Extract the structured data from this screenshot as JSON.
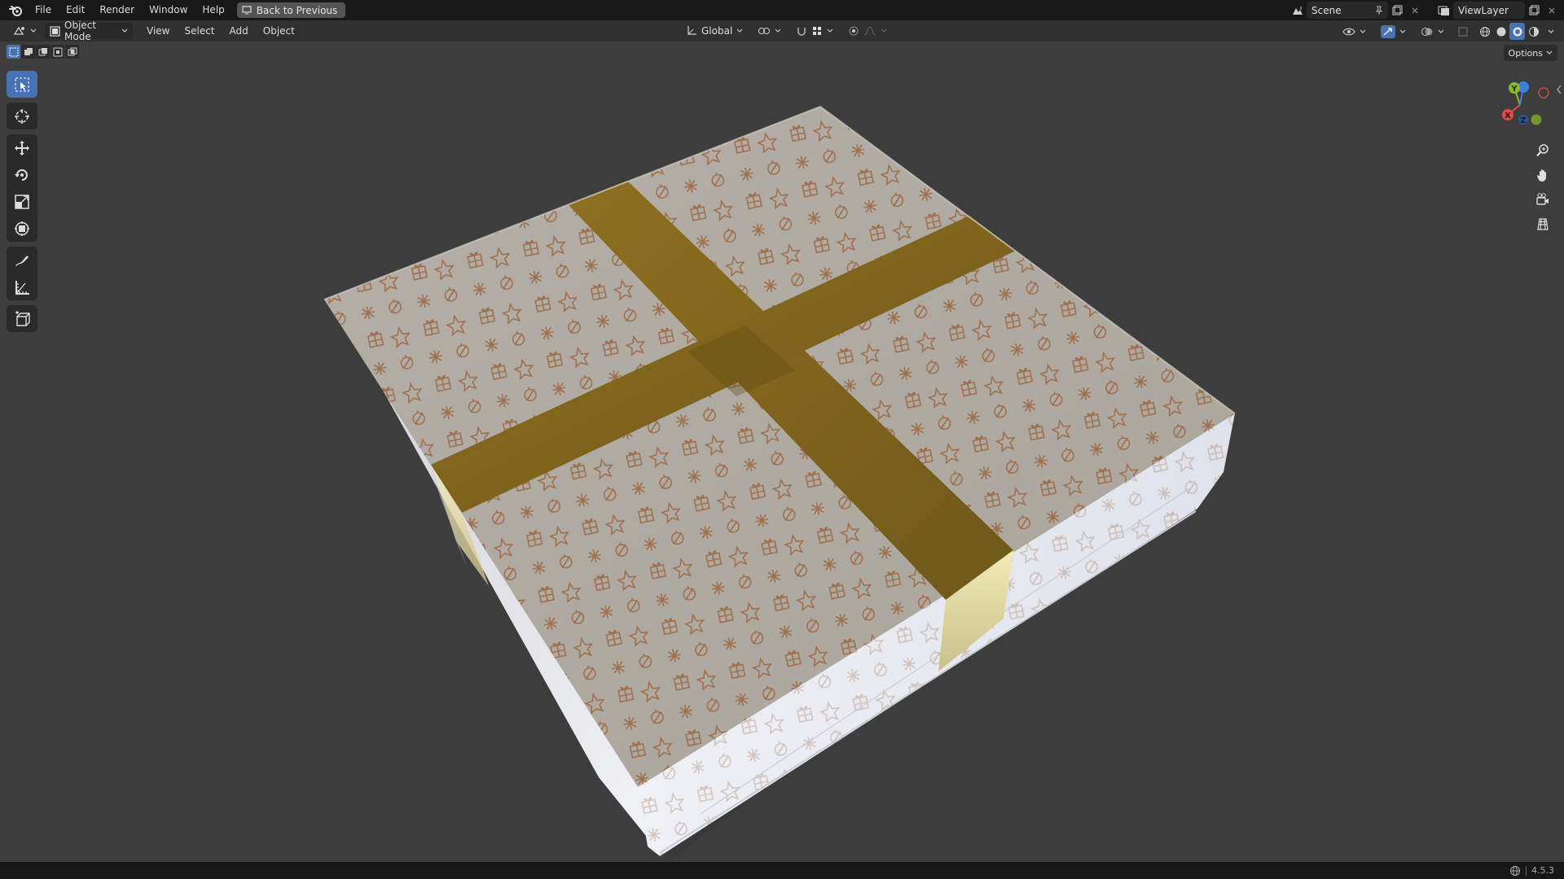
{
  "menu": {
    "items": [
      "File",
      "Edit",
      "Render",
      "Window",
      "Help"
    ],
    "back_button": "Back to Previous"
  },
  "scene": {
    "name": "Scene"
  },
  "view_layer": {
    "name": "ViewLayer"
  },
  "viewport_header": {
    "mode": "Object Mode",
    "menus": [
      "View",
      "Select",
      "Add",
      "Object"
    ],
    "transform_orientation": "Global"
  },
  "options_label": "Options",
  "gizmo": {
    "x_label": "X",
    "y_label": "Y",
    "z_label": "Z"
  },
  "status": {
    "version": "4.5.3"
  },
  "colors": {
    "accent": "#4772b3",
    "viewport_bg": "#3d3d3d",
    "ribbon": "#8a6e1c",
    "paper": "#b5b1a8"
  }
}
